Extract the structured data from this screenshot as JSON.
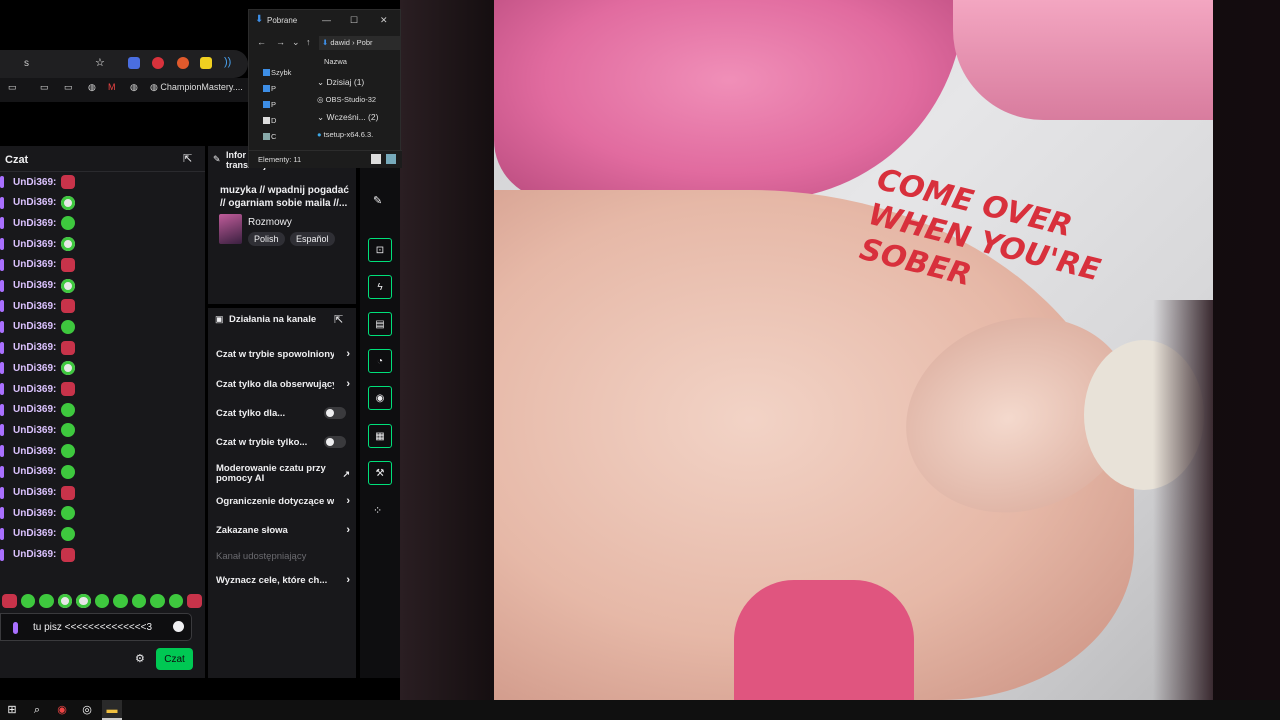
{
  "browser": {
    "address_text": "s",
    "bookmark_label": "ChampionMastery...."
  },
  "explorer": {
    "title": "Pobrane",
    "path_user": "dawid",
    "path_folder": "Pobr",
    "sidebar": [
      "Szybk",
      "P",
      "P",
      "D",
      "C"
    ],
    "column_header": "Nazwa",
    "groups": [
      {
        "label": "Dzisiaj (1)",
        "files": [
          "OBS-Studio-32"
        ]
      },
      {
        "label": "Wcześni... (2)",
        "files": [
          "tsetup-x64.6.3."
        ]
      }
    ],
    "status": "Elementy: 11",
    "controls": {
      "minimize": "—",
      "maximize": "☐",
      "close": "✕"
    }
  },
  "chat": {
    "title": "Czat",
    "messages": [
      {
        "user": "UnDi369:",
        "emote": "red"
      },
      {
        "user": "UnDi369:",
        "emote": "ghost"
      },
      {
        "user": "UnDi369:",
        "emote": "green"
      },
      {
        "user": "UnDi369:",
        "emote": "ghost"
      },
      {
        "user": "UnDi369:",
        "emote": "red"
      },
      {
        "user": "UnDi369:",
        "emote": "ghost"
      },
      {
        "user": "UnDi369:",
        "emote": "red"
      },
      {
        "user": "UnDi369:",
        "emote": "green"
      },
      {
        "user": "UnDi369:",
        "emote": "red"
      },
      {
        "user": "UnDi369:",
        "emote": "ghost"
      },
      {
        "user": "UnDi369:",
        "emote": "red"
      },
      {
        "user": "UnDi369:",
        "emote": "green"
      },
      {
        "user": "UnDi369:",
        "emote": "green"
      },
      {
        "user": "UnDi369:",
        "emote": "green"
      },
      {
        "user": "UnDi369:",
        "emote": "green"
      },
      {
        "user": "UnDi369:",
        "emote": "red"
      },
      {
        "user": "UnDi369:",
        "emote": "green"
      },
      {
        "user": "UnDi369:",
        "emote": "green"
      },
      {
        "user": "UnDi369:",
        "emote": "red"
      }
    ],
    "emote_bar": [
      "red",
      "green",
      "green",
      "ghost",
      "ghost",
      "green",
      "green",
      "green",
      "green",
      "green",
      "red"
    ],
    "input_value": "tu pisz <<<<<<<<<<<<<<3",
    "send_label": "Czat"
  },
  "stream_info": {
    "title": "Infor transmisji",
    "stream_title": "muzyka // wpadnij pogadać // ogarniam sobie maila //...",
    "category": "Rozmowy",
    "tags": [
      "Polish",
      "Español"
    ]
  },
  "channel_actions": {
    "title": "Działania na kanale",
    "items": [
      {
        "label": "Czat w trybie spowolnionym",
        "control": "chevron"
      },
      {
        "label": "Czat tylko dla obserwujących",
        "control": "chevron"
      },
      {
        "label": "Czat tylko dla...",
        "control": "toggle"
      },
      {
        "label": "Czat w trybie tylko...",
        "control": "toggle"
      },
      {
        "label": "Moderowanie czatu przy pomocy AI",
        "control": "external"
      },
      {
        "label": "Ograniczenie dotyczące w",
        "control": "chevron"
      },
      {
        "label": "Zakazane słowa",
        "control": "chevron"
      },
      {
        "label": "Kanał udostępniający",
        "control": "none"
      },
      {
        "label": "Wyznacz cele, które ch...",
        "control": "chevron"
      }
    ]
  },
  "album": {
    "text": "COME OVER\nWHEN YOU'RE\nSOBER"
  },
  "colors": {
    "accent": "#00c853",
    "twitch_purple": "#a970ff",
    "panel": "#18181b",
    "album_text": "#d8303c"
  }
}
